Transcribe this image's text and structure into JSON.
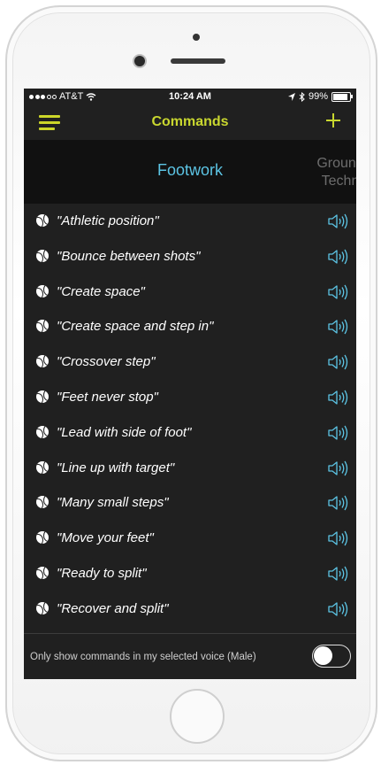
{
  "status_bar": {
    "carrier": "AT&T",
    "time": "10:24 AM",
    "battery": "99%",
    "icons": [
      "signal-dots-icon",
      "wifi-icon",
      "location-icon",
      "bluetooth-icon",
      "battery-icon"
    ]
  },
  "nav": {
    "title": "Commands",
    "menu_icon": "hamburger-icon",
    "add_icon": "plus-icon",
    "accent_color": "#c9d72f"
  },
  "tabs": {
    "active": "Footwork",
    "next_line1": "Ground",
    "next_line2": "Techn",
    "active_color": "#5cc4e4"
  },
  "commands": [
    "\"Athletic position\"",
    "\"Bounce between shots\"",
    "\"Create space\"",
    "\"Create space and step in\"",
    "\"Crossover step\"",
    "\"Feet never stop\"",
    "\"Lead with side of foot\"",
    "\"Line up with target\"",
    "\"Many small steps\"",
    "\"Move your feet\"",
    "\"Ready to split\"",
    "\"Recover and split\""
  ],
  "row_icons": {
    "leading": "tennis-ball-icon",
    "trailing": "speaker-icon"
  },
  "footer": {
    "label": "Only show commands in my selected voice  (Male)",
    "toggle_on": false
  }
}
